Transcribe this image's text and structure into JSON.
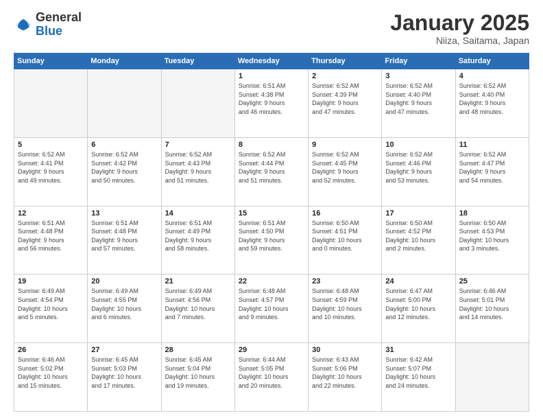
{
  "header": {
    "logo_general": "General",
    "logo_blue": "Blue",
    "month_title": "January 2025",
    "location": "Niiza, Saitama, Japan"
  },
  "weekdays": [
    "Sunday",
    "Monday",
    "Tuesday",
    "Wednesday",
    "Thursday",
    "Friday",
    "Saturday"
  ],
  "weeks": [
    [
      {
        "day": "",
        "info": "",
        "empty": true
      },
      {
        "day": "",
        "info": "",
        "empty": true
      },
      {
        "day": "",
        "info": "",
        "empty": true
      },
      {
        "day": "1",
        "info": "Sunrise: 6:51 AM\nSunset: 4:38 PM\nDaylight: 9 hours\nand 46 minutes.",
        "empty": false
      },
      {
        "day": "2",
        "info": "Sunrise: 6:52 AM\nSunset: 4:39 PM\nDaylight: 9 hours\nand 47 minutes.",
        "empty": false
      },
      {
        "day": "3",
        "info": "Sunrise: 6:52 AM\nSunset: 4:40 PM\nDaylight: 9 hours\nand 47 minutes.",
        "empty": false
      },
      {
        "day": "4",
        "info": "Sunrise: 6:52 AM\nSunset: 4:40 PM\nDaylight: 9 hours\nand 48 minutes.",
        "empty": false
      }
    ],
    [
      {
        "day": "5",
        "info": "Sunrise: 6:52 AM\nSunset: 4:41 PM\nDaylight: 9 hours\nand 49 minutes.",
        "empty": false
      },
      {
        "day": "6",
        "info": "Sunrise: 6:52 AM\nSunset: 4:42 PM\nDaylight: 9 hours\nand 50 minutes.",
        "empty": false
      },
      {
        "day": "7",
        "info": "Sunrise: 6:52 AM\nSunset: 4:43 PM\nDaylight: 9 hours\nand 51 minutes.",
        "empty": false
      },
      {
        "day": "8",
        "info": "Sunrise: 6:52 AM\nSunset: 4:44 PM\nDaylight: 9 hours\nand 51 minutes.",
        "empty": false
      },
      {
        "day": "9",
        "info": "Sunrise: 6:52 AM\nSunset: 4:45 PM\nDaylight: 9 hours\nand 52 minutes.",
        "empty": false
      },
      {
        "day": "10",
        "info": "Sunrise: 6:52 AM\nSunset: 4:46 PM\nDaylight: 9 hours\nand 53 minutes.",
        "empty": false
      },
      {
        "day": "11",
        "info": "Sunrise: 6:52 AM\nSunset: 4:47 PM\nDaylight: 9 hours\nand 54 minutes.",
        "empty": false
      }
    ],
    [
      {
        "day": "12",
        "info": "Sunrise: 6:51 AM\nSunset: 4:48 PM\nDaylight: 9 hours\nand 56 minutes.",
        "empty": false
      },
      {
        "day": "13",
        "info": "Sunrise: 6:51 AM\nSunset: 4:48 PM\nDaylight: 9 hours\nand 57 minutes.",
        "empty": false
      },
      {
        "day": "14",
        "info": "Sunrise: 6:51 AM\nSunset: 4:49 PM\nDaylight: 9 hours\nand 58 minutes.",
        "empty": false
      },
      {
        "day": "15",
        "info": "Sunrise: 6:51 AM\nSunset: 4:50 PM\nDaylight: 9 hours\nand 59 minutes.",
        "empty": false
      },
      {
        "day": "16",
        "info": "Sunrise: 6:50 AM\nSunset: 4:51 PM\nDaylight: 10 hours\nand 0 minutes.",
        "empty": false
      },
      {
        "day": "17",
        "info": "Sunrise: 6:50 AM\nSunset: 4:52 PM\nDaylight: 10 hours\nand 2 minutes.",
        "empty": false
      },
      {
        "day": "18",
        "info": "Sunrise: 6:50 AM\nSunset: 4:53 PM\nDaylight: 10 hours\nand 3 minutes.",
        "empty": false
      }
    ],
    [
      {
        "day": "19",
        "info": "Sunrise: 6:49 AM\nSunset: 4:54 PM\nDaylight: 10 hours\nand 5 minutes.",
        "empty": false
      },
      {
        "day": "20",
        "info": "Sunrise: 6:49 AM\nSunset: 4:55 PM\nDaylight: 10 hours\nand 6 minutes.",
        "empty": false
      },
      {
        "day": "21",
        "info": "Sunrise: 6:49 AM\nSunset: 4:56 PM\nDaylight: 10 hours\nand 7 minutes.",
        "empty": false
      },
      {
        "day": "22",
        "info": "Sunrise: 6:48 AM\nSunset: 4:57 PM\nDaylight: 10 hours\nand 9 minutes.",
        "empty": false
      },
      {
        "day": "23",
        "info": "Sunrise: 6:48 AM\nSunset: 4:59 PM\nDaylight: 10 hours\nand 10 minutes.",
        "empty": false
      },
      {
        "day": "24",
        "info": "Sunrise: 6:47 AM\nSunset: 5:00 PM\nDaylight: 10 hours\nand 12 minutes.",
        "empty": false
      },
      {
        "day": "25",
        "info": "Sunrise: 6:46 AM\nSunset: 5:01 PM\nDaylight: 10 hours\nand 14 minutes.",
        "empty": false
      }
    ],
    [
      {
        "day": "26",
        "info": "Sunrise: 6:46 AM\nSunset: 5:02 PM\nDaylight: 10 hours\nand 15 minutes.",
        "empty": false
      },
      {
        "day": "27",
        "info": "Sunrise: 6:45 AM\nSunset: 5:03 PM\nDaylight: 10 hours\nand 17 minutes.",
        "empty": false
      },
      {
        "day": "28",
        "info": "Sunrise: 6:45 AM\nSunset: 5:04 PM\nDaylight: 10 hours\nand 19 minutes.",
        "empty": false
      },
      {
        "day": "29",
        "info": "Sunrise: 6:44 AM\nSunset: 5:05 PM\nDaylight: 10 hours\nand 20 minutes.",
        "empty": false
      },
      {
        "day": "30",
        "info": "Sunrise: 6:43 AM\nSunset: 5:06 PM\nDaylight: 10 hours\nand 22 minutes.",
        "empty": false
      },
      {
        "day": "31",
        "info": "Sunrise: 6:42 AM\nSunset: 5:07 PM\nDaylight: 10 hours\nand 24 minutes.",
        "empty": false
      },
      {
        "day": "",
        "info": "",
        "empty": true
      }
    ]
  ]
}
